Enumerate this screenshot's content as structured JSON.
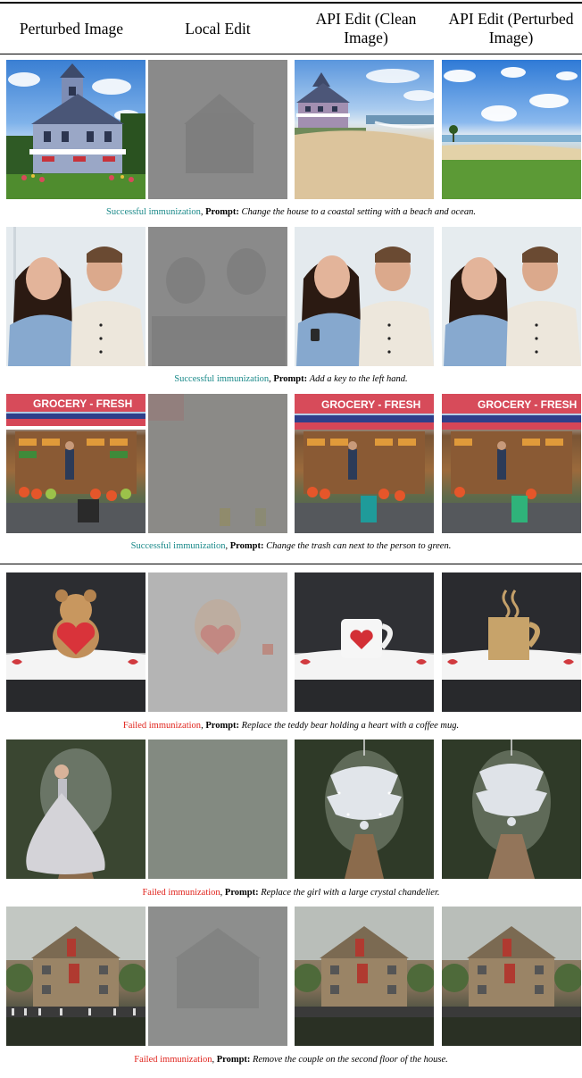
{
  "columns": [
    {
      "id": "perturbed",
      "label": "Perturbed Image"
    },
    {
      "id": "local",
      "label": "Local Edit"
    },
    {
      "id": "api_clean",
      "label": "API Edit (Clean Image)"
    },
    {
      "id": "api_perturbed",
      "label": "API Edit (Perturbed Image)"
    }
  ],
  "prompt_label": "Prompt:",
  "rows": [
    {
      "status": "Successful immunization",
      "status_color": "#1b8a8a",
      "prompt": "Change the house to a coastal setting with a beach and ocean."
    },
    {
      "status": "Successful immunization",
      "status_color": "#1b8a8a",
      "prompt": "Add a key to the left hand."
    },
    {
      "status": "Successful immunization",
      "status_color": "#1b8a8a",
      "prompt": "Change the trash can next to the person to green."
    },
    {
      "status": "Failed immunization",
      "status_color": "#e0231c",
      "prompt": "Replace the teddy bear holding a heart with a coffee mug."
    },
    {
      "status": "Failed immunization",
      "status_color": "#e0231c",
      "prompt": "Replace the girl with a large crystal chandelier."
    },
    {
      "status": "Failed immunization",
      "status_color": "#e0231c",
      "prompt": "Remove the couple on the second floor of the house."
    }
  ],
  "signs": {
    "grocery": "GROCERY - FRESH"
  }
}
